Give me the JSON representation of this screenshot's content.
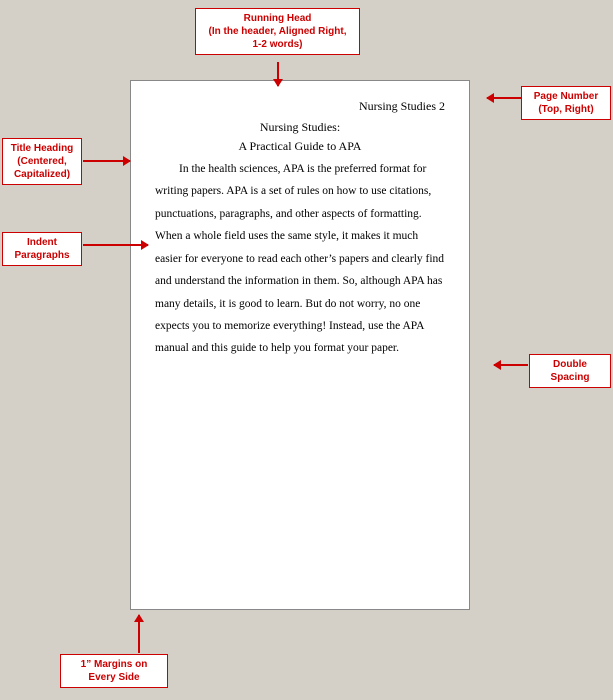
{
  "page": {
    "header": "Nursing Studies   2",
    "title": "Nursing Studies:",
    "subtitle": "A Practical Guide to APA",
    "body": "In the health sciences, APA is the preferred format for writing papers.  APA is a set of rules on how to use citations, punctuations, paragraphs, and other aspects of formatting.  When a whole field uses the same style, it makes it much easier for everyone to read each other’s papers and clearly find and understand the information in them.  So, although APA has many details, it is good to learn. But do not worry, no one expects you to memorize everything!  Instead, use the APA manual and this guide to help you format your paper."
  },
  "labels": {
    "running_head": "Running Head\n(In the header, Aligned Right,\n1-2 words)",
    "page_number": "Page Number\n(Top, Right)",
    "title_heading": "Title Heading\n(Centered,\nCapitalized)",
    "indent": "Indent\nParagraphs",
    "double_spacing": "Double\nSpacing",
    "margins": "1” Margins on\nEvery Side"
  }
}
